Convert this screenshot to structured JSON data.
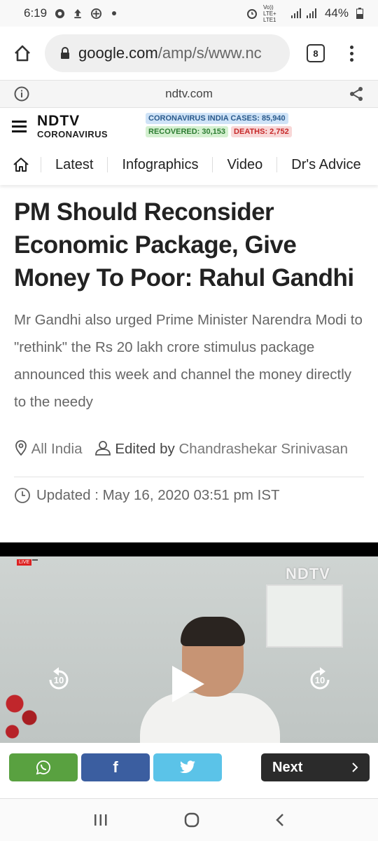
{
  "status": {
    "time": "6:19",
    "battery": "44%",
    "network": "Vo)) LTE+ LTE1"
  },
  "browser": {
    "url_bold": "google.com",
    "url_rest": "/amp/s/www.nc",
    "tab_count": "8"
  },
  "amp": {
    "host": "ndtv.com"
  },
  "header": {
    "logo_top": "NDTV",
    "logo_bottom": "CORONAVIRUS",
    "cases": "CORONAVIRUS INDIA CASES: 85,940",
    "recovered": "RECOVERED: 30,153",
    "deaths": "DEATHS: 2,752"
  },
  "nav": {
    "items": [
      "Latest",
      "Infographics",
      "Video",
      "Dr's Advice"
    ]
  },
  "article": {
    "title": "PM Should Reconsider Economic Package, Give Money To Poor: Rahul Gandhi",
    "summary": "Mr Gandhi also urged Prime Minister Narendra Modi to \"rethink\" the Rs 20 lakh crore stimulus package announced this week and channel the money directly to the needy",
    "location": "All India",
    "edited_label": "Edited by",
    "editor": "Chandrashekar Srinivasan",
    "updated": "Updated : May 16, 2020 03:51 pm IST"
  },
  "video": {
    "watermark": "NDTV",
    "live": "LIVE",
    "rewind_seconds": "10",
    "forward_seconds": "10"
  },
  "share": {
    "facebook": "f",
    "next_label": "Next"
  },
  "colors": {
    "whatsapp": "#59a140",
    "facebook": "#3b5ea0",
    "twitter": "#5bc3e8",
    "next": "#2b2b2b"
  }
}
